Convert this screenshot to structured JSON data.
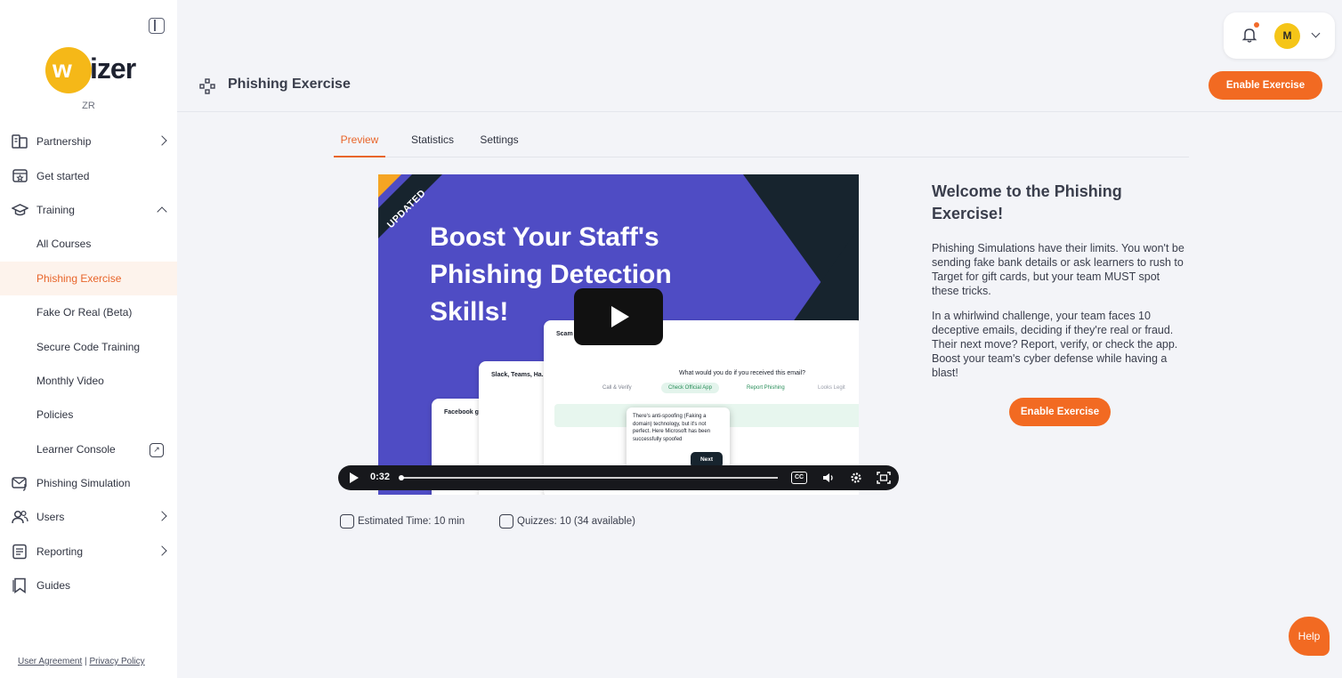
{
  "brand": {
    "logo_text": "izer",
    "logo_letter": "w",
    "org": "ZR",
    "accent": "#f26a22",
    "sidebar_active_bg": "#fdf3ec"
  },
  "sidebar": {
    "items": [
      {
        "label": "Partnership",
        "icon": "partnership-icon"
      },
      {
        "label": "Get started",
        "icon": "calendar-star-icon"
      },
      {
        "label": "Training",
        "icon": "graduation-cap-icon"
      },
      {
        "label": "All Courses"
      },
      {
        "label": "Phishing Exercise"
      },
      {
        "label": "Fake Or Real (Beta)"
      },
      {
        "label": "Secure Code Training"
      },
      {
        "label": "Monthly Video"
      },
      {
        "label": "Policies"
      },
      {
        "label": "Learner Console",
        "icon": "external-link-icon"
      },
      {
        "label": "Phishing Simulation",
        "icon": "mail-hook-icon"
      },
      {
        "label": "Users",
        "icon": "users-icon"
      },
      {
        "label": "Reporting",
        "icon": "report-icon"
      },
      {
        "label": "Guides",
        "icon": "bookmark-icon"
      }
    ],
    "footer": {
      "user_agreement": "User Agreement",
      "separator": "|",
      "privacy": "Privacy Policy"
    }
  },
  "header": {
    "avatar_initial": "M",
    "title": "Phishing Exercise",
    "enable_label": "Enable Exercise"
  },
  "tabs": [
    {
      "label": "Preview"
    },
    {
      "label": "Statistics"
    },
    {
      "label": "Settings"
    }
  ],
  "video": {
    "badge": "UPDATED",
    "headline_line1": "Boost Your Staff's",
    "headline_line2": "Phishing Detection",
    "headline_line3": "Skills!",
    "card_question": "What would you do if you received this email?",
    "option_call": "Call & Verify",
    "option_app": "Check Official App",
    "option_report": "Report Phishing",
    "option_legit": "Looks Legit",
    "card_scam": "Scam",
    "card_slack": "Slack, Teams, Ha...",
    "card_facebook": "Facebook g...",
    "popup_text": "There's anti-spoofing (Faking a domain) technology, but it's not perfect. Here Microsoft has been successfully spoofed",
    "popup_next": "Next",
    "time": "0:32",
    "progress": 0.0
  },
  "meta": {
    "estimated_time": "Estimated Time: 10 min",
    "quizzes": "Quizzes: 10 (34 available)"
  },
  "description": {
    "title": "Welcome to the Phishing Exercise!",
    "para1": "Phishing Simulations have their limits. You won't be sending fake bank details or ask learners to rush to Target for gift cards, but your team MUST spot these tricks.",
    "para2": "In a whirlwind challenge, your team faces 10 deceptive emails, deciding if they're real or fraud. Their next move? Report, verify, or check the app. Boost your team's cyber defense while having a blast!",
    "enable_label": "Enable Exercise"
  },
  "help_label": "Help"
}
